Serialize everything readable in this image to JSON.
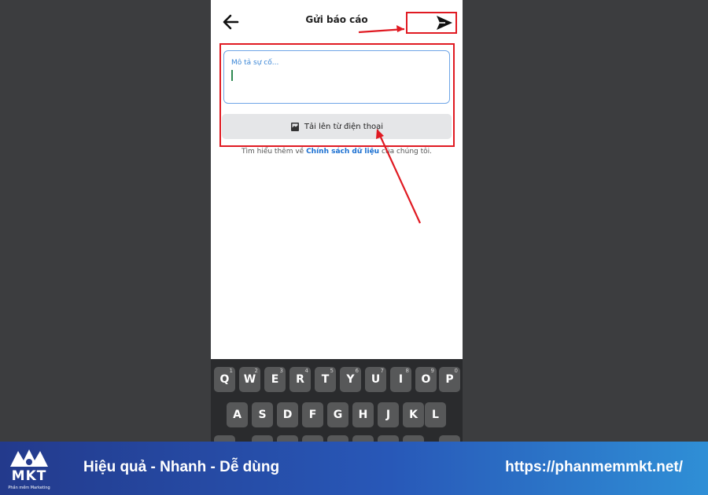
{
  "header": {
    "title": "Gửi báo cáo",
    "back_icon": "arrow-left-icon",
    "send_icon": "paper-plane-icon"
  },
  "form": {
    "description_placeholder": "Mô tả sự cố...",
    "upload_label": "Tải lên từ điện thoại",
    "upload_icon": "image-file-icon"
  },
  "policy": {
    "prefix": "Tìm hiểu thêm về ",
    "link": "Chính sách dữ liệu",
    "suffix": " của chúng tôi."
  },
  "keyboard": {
    "row1": [
      {
        "key": "Q",
        "num": "1"
      },
      {
        "key": "W",
        "num": "2"
      },
      {
        "key": "E",
        "num": "3"
      },
      {
        "key": "R",
        "num": "4"
      },
      {
        "key": "T",
        "num": "5"
      },
      {
        "key": "Y",
        "num": "6"
      },
      {
        "key": "U",
        "num": "7"
      },
      {
        "key": "I",
        "num": "8"
      },
      {
        "key": "O",
        "num": "9"
      },
      {
        "key": "P",
        "num": "0"
      }
    ],
    "row2": [
      "A",
      "S",
      "D",
      "F",
      "G",
      "H",
      "J",
      "K",
      "L"
    ]
  },
  "annotation": {
    "highlight_color": "#e01a22"
  },
  "footer": {
    "logo_text": "MKT",
    "logo_sub": "Phần mềm Marketing",
    "slogan": "Hiệu quả - Nhanh - Dễ dùng",
    "url": "https://phanmemmkt.net/"
  }
}
